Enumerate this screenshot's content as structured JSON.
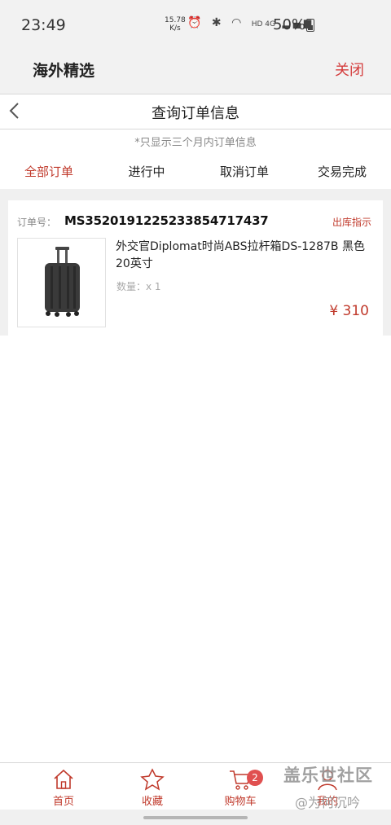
{
  "status_bar": {
    "time": "23:49",
    "speed_value": "15.78",
    "speed_unit": "K/s",
    "icons": [
      "alarm-icon",
      "bluetooth-icon",
      "wifi-icon",
      "hd-icon",
      "4g-signal-icon"
    ],
    "net_label": "HD 4G",
    "battery": "50%"
  },
  "app_bar": {
    "title": "海外精选",
    "close_label": "关闭"
  },
  "page_header": {
    "title": "查询订单信息"
  },
  "notice": "*只显示三个月内订单信息",
  "tabs": [
    {
      "label": "全部订单",
      "active": true
    },
    {
      "label": "进行中",
      "active": false
    },
    {
      "label": "取消订单",
      "active": false
    },
    {
      "label": "交易完成",
      "active": false
    }
  ],
  "order": {
    "number_label": "订单号：",
    "number": "MS35201912252338547174​37",
    "action": "出库指示",
    "product": {
      "name": "外交官Diplomat时尚ABS拉杆箱DS-1287B 黑色 20英寸",
      "quantity": "数量：x 1",
      "price": "¥ 310"
    }
  },
  "bottom_nav": {
    "items": [
      {
        "label": "首页",
        "icon": "home-icon"
      },
      {
        "label": "收藏",
        "icon": "star-icon"
      },
      {
        "label": "购物车",
        "icon": "cart-icon",
        "badge": "2"
      },
      {
        "label": "我的",
        "icon": "user-icon"
      }
    ]
  },
  "watermark": {
    "line1": "盖乐世社区",
    "line2": "@为何沉吟"
  },
  "colors": {
    "accent": "#c0392b",
    "badge": "#e05050",
    "header_bg": "#f2f2f2"
  }
}
